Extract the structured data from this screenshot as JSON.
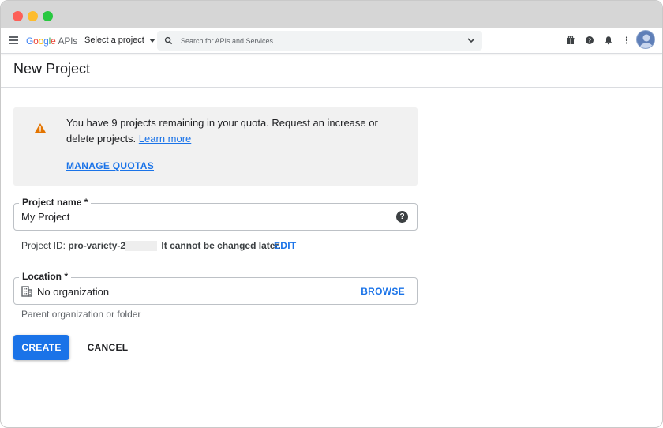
{
  "header": {
    "logo": {
      "letters": [
        "G",
        "o",
        "o",
        "g",
        "l",
        "e"
      ],
      "suffix": "APIs"
    },
    "project_selector": "Select a project",
    "search": {
      "placeholder": "Search for APIs and Services"
    },
    "icons": [
      "gift-icon",
      "help-icon",
      "bell-icon",
      "more-vert-icon",
      "avatar"
    ]
  },
  "page": {
    "title": "New Project"
  },
  "quota_notice": {
    "message": "You have 9 projects remaining in your quota. Request an increase or delete projects.",
    "learn_more": "Learn more",
    "manage_quotas": "MANAGE QUOTAS"
  },
  "project_name": {
    "label": "Project name *",
    "value": "My Project"
  },
  "project_id": {
    "prefix": "Project ID:",
    "value": "pro-variety-2",
    "note": "It cannot be changed later.",
    "edit": "EDIT"
  },
  "location": {
    "label": "Location *",
    "value": "No organization",
    "browse": "BROWSE",
    "helper": "Parent organization or folder"
  },
  "actions": {
    "create": "CREATE",
    "cancel": "CANCEL"
  },
  "colors": {
    "accent": "#1a73e8",
    "warning": "#e37400",
    "notice_bg": "#f1f1f1"
  }
}
